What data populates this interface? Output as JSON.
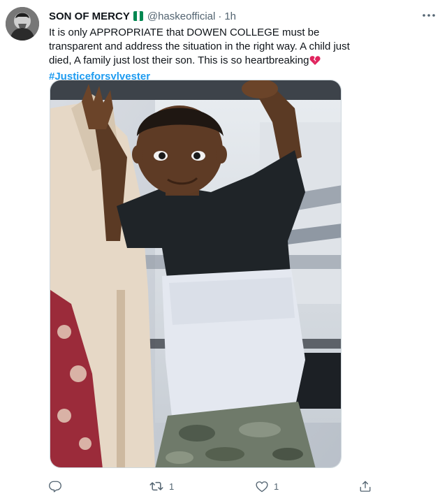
{
  "tweet": {
    "author": {
      "display_name": "SON OF MERCY",
      "handle": "@haskeofficial",
      "separator": "·",
      "time": "1h",
      "flag_colors": [
        "#008751",
        "#ffffff",
        "#008751"
      ]
    },
    "text": {
      "main": "It is only APPROPRIATE that DOWEN COLLEGE must be transparent and address the situation in the right way. A child just died, A family just lost their son. This is so heartbreaking",
      "emoji": "broken-heart-icon",
      "hashtag": "#Justiceforsylvester"
    },
    "media": {
      "image": "photo"
    },
    "actions": {
      "reply_icon": "reply-icon",
      "reply_count": "",
      "retweet_icon": "retweet-icon",
      "retweet_count": "1",
      "like_icon": "heart-icon",
      "like_count": "1",
      "share_icon": "share-icon"
    }
  },
  "colors": {
    "text_primary": "#0f1419",
    "text_secondary": "#536471",
    "link": "#1d9bf0",
    "broken_heart": "#e0245e"
  }
}
